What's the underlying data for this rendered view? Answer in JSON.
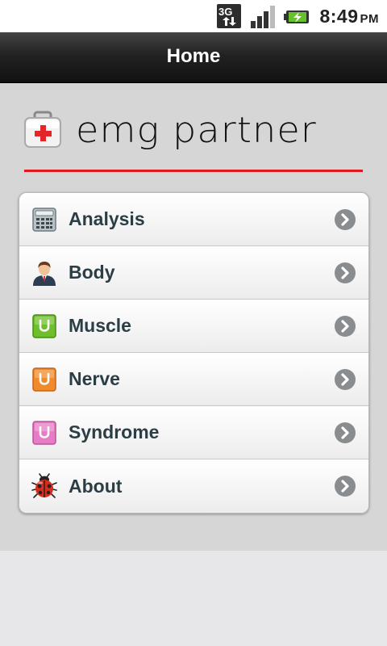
{
  "status_bar": {
    "network_label": "3G",
    "time": "8:49",
    "ampm": "PM"
  },
  "header": {
    "title": "Home"
  },
  "brand": {
    "name": "emg partner",
    "rule_color": "#e0191f"
  },
  "menu": {
    "items": [
      {
        "label": "Analysis",
        "icon": "calculator-icon"
      },
      {
        "label": "Body",
        "icon": "person-icon"
      },
      {
        "label": "Muscle",
        "icon": "green-magnet-icon",
        "color": "#6fbf2a"
      },
      {
        "label": "Nerve",
        "icon": "orange-magnet-icon",
        "color": "#f18a2a"
      },
      {
        "label": "Syndrome",
        "icon": "pink-magnet-icon",
        "color": "#e87cc4"
      },
      {
        "label": "About",
        "icon": "ladybug-icon"
      }
    ]
  }
}
